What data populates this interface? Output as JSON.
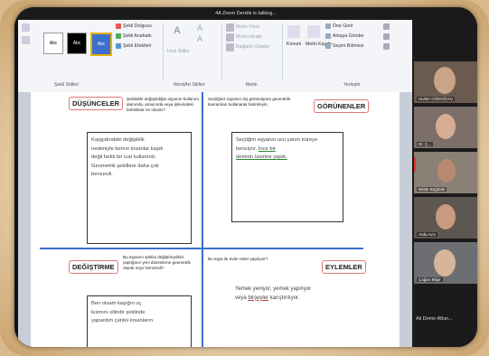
{
  "window": {
    "title": "4A Zoom Derslik is talking..."
  },
  "ribbon": {
    "styles_label": "Şekil Stilleri",
    "wordart_label": "WordArt Stilleri",
    "text_label": "Metin",
    "arrange_label": "Yerleştir",
    "style_samples": [
      "Abc",
      "Abc",
      "Abc"
    ],
    "shape_fill": "Şekil Dolgusu",
    "shape_outline": "Şekil Anahattı",
    "shape_effects": "Şekil Efektleri",
    "quick_styles": "Hızlı Stiller",
    "text_direction": "Metin Yönü",
    "align_text": "Metni Hizala",
    "create_link": "Bağlantı Oluştur",
    "position": "Konum",
    "wrap_text": "Metni Kaydır",
    "bring_forward": "Öne Getir",
    "send_backward": "Arkaya Gönder",
    "selection_pane": "Seçim Bölmesi"
  },
  "document": {
    "sections": [
      {
        "label": "DÜŞÜNCELER",
        "question": "Şekildeki değiştirdiğin eşyanın kullanım alanında, amacında veya işlevindeki farklılıklar ne olurdu?",
        "answer": [
          "Kaygıdındaki değişiklik",
          "nedeniyle bence insanlar kaşık",
          "değil farklı bir icat kullanırdı.",
          "Geometrik şekillere daha çok",
          "benzerdi."
        ]
      },
      {
        "label": "GÖRÜNENLER",
        "question": "Seçtiğiniz eşyanın dış görünüşünü geometrik kavramları kullanarak betimleyin.",
        "answer_plain": "Seçtiğim eşyanın ucu yarım küreye benziyor. ",
        "answer_underlined_1": "İnce bir",
        "answer_underlined_2": "demirin üzerine yapık."
      },
      {
        "label": "DEĞİŞTİRME",
        "question": "Bu eşyanın şeklini değiştireydiniz yaptığınız yeni düzenleme geometrik olarak neye benzerdi?",
        "answer": [
          "Ben olsam kaşığın uç",
          "kısmını silindir şeklinde",
          "yapardım çünkü insanların"
        ]
      },
      {
        "label": "EYLEMLER",
        "question": "Bu eşya ile evde neler yapılıyor?",
        "answer_plain_1": "Yemek yeniyor, yemek yapılıyor",
        "answer_plain_2": "veya ",
        "answer_underlined": "birşeyler",
        "answer_plain_3": " karıştırılıyor."
      }
    ]
  },
  "participants": [
    {
      "name": "HUMA GÖDOĞAN"
    },
    {
      "name": "Dr. Ç..."
    },
    {
      "name": "Belde Bağdatlı"
    },
    {
      "name": "Arda Avcı"
    },
    {
      "name": "Çağan Bilge"
    },
    {
      "name": "Ali Demir Altun..."
    }
  ],
  "colors": {
    "accent": "#3b6fd0",
    "label_border": "#dd7777"
  }
}
